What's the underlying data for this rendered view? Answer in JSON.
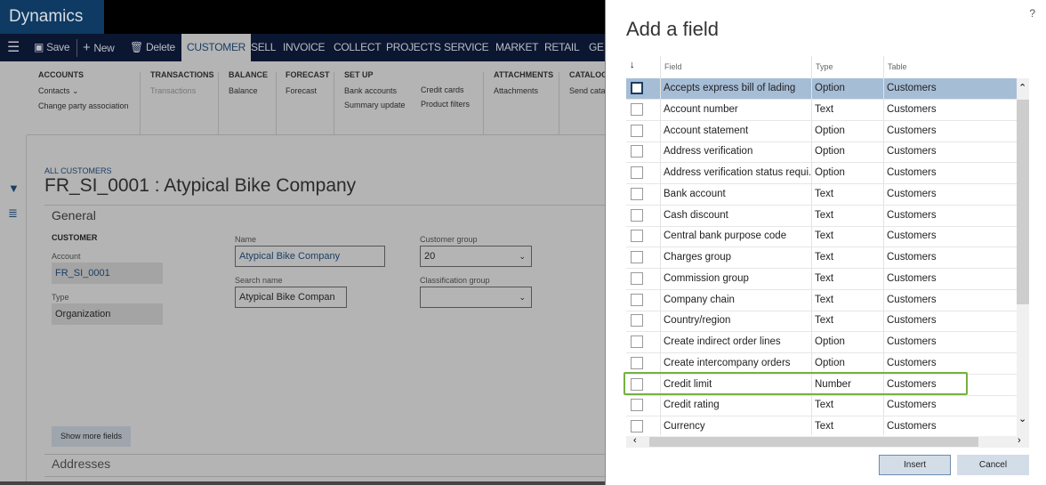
{
  "app": {
    "title": "Dynamics AX"
  },
  "nav": {
    "save": "Save",
    "new": "New",
    "delete": "Delete",
    "tabs": [
      "CUSTOMER",
      "SELL",
      "INVOICE",
      "COLLECT",
      "PROJECTS",
      "SERVICE",
      "MARKET",
      "RETAIL",
      "GE"
    ]
  },
  "ribbon": {
    "accounts": {
      "title": "ACCOUNTS",
      "items": [
        "Contacts ⌄",
        "Change party association"
      ]
    },
    "transactions": {
      "title": "TRANSACTIONS",
      "items": [
        "Transactions"
      ]
    },
    "balance": {
      "title": "BALANCE",
      "items": [
        "Balance"
      ]
    },
    "forecast": {
      "title": "FORECAST",
      "items": [
        "Forecast"
      ]
    },
    "setup": {
      "title": "SET UP",
      "items": [
        "Bank accounts",
        "Summary update",
        "Credit cards",
        "Product filters"
      ]
    },
    "attachments": {
      "title": "ATTACHMENTS",
      "items": [
        "Attachments"
      ]
    },
    "catalogs": {
      "title": "CATALOGS",
      "items": [
        "Send cata"
      ]
    }
  },
  "page": {
    "breadcrumb": "ALL CUSTOMERS",
    "title": "FR_SI_0001 : Atypical Bike Company",
    "section": "General",
    "group": "CUSTOMER",
    "account_label": "Account",
    "account": "FR_SI_0001",
    "type_label": "Type",
    "type": "Organization",
    "name_label": "Name",
    "name": "Atypical Bike Company",
    "search_label": "Search name",
    "search": "Atypical Bike Compan",
    "custgroup_label": "Customer group",
    "custgroup": "20",
    "class_label": "Classification group",
    "class": "",
    "show_more": "Show more fields",
    "addresses": "Addresses"
  },
  "dialog": {
    "title": "Add a field",
    "help": "?",
    "sort_icon": "↓",
    "columns": [
      "Field",
      "Type",
      "Table"
    ],
    "rows": [
      [
        "Accepts express bill of lading",
        "Option",
        "Customers"
      ],
      [
        "Account number",
        "Text",
        "Customers"
      ],
      [
        "Account statement",
        "Option",
        "Customers"
      ],
      [
        "Address verification",
        "Option",
        "Customers"
      ],
      [
        "Address verification status requi...",
        "Option",
        "Customers"
      ],
      [
        "Bank account",
        "Text",
        "Customers"
      ],
      [
        "Cash discount",
        "Text",
        "Customers"
      ],
      [
        "Central bank purpose code",
        "Text",
        "Customers"
      ],
      [
        "Charges group",
        "Text",
        "Customers"
      ],
      [
        "Commission group",
        "Text",
        "Customers"
      ],
      [
        "Company chain",
        "Text",
        "Customers"
      ],
      [
        "Country/region",
        "Text",
        "Customers"
      ],
      [
        "Create indirect order lines",
        "Option",
        "Customers"
      ],
      [
        "Create intercompany orders",
        "Option",
        "Customers"
      ],
      [
        "Credit limit",
        "Number",
        "Customers"
      ],
      [
        "Credit rating",
        "Text",
        "Customers"
      ],
      [
        "Currency",
        "Text",
        "Customers"
      ]
    ],
    "insert": "Insert",
    "cancel": "Cancel"
  },
  "colors": {
    "accent": "#77b041",
    "selected": "#a6bdd6"
  }
}
